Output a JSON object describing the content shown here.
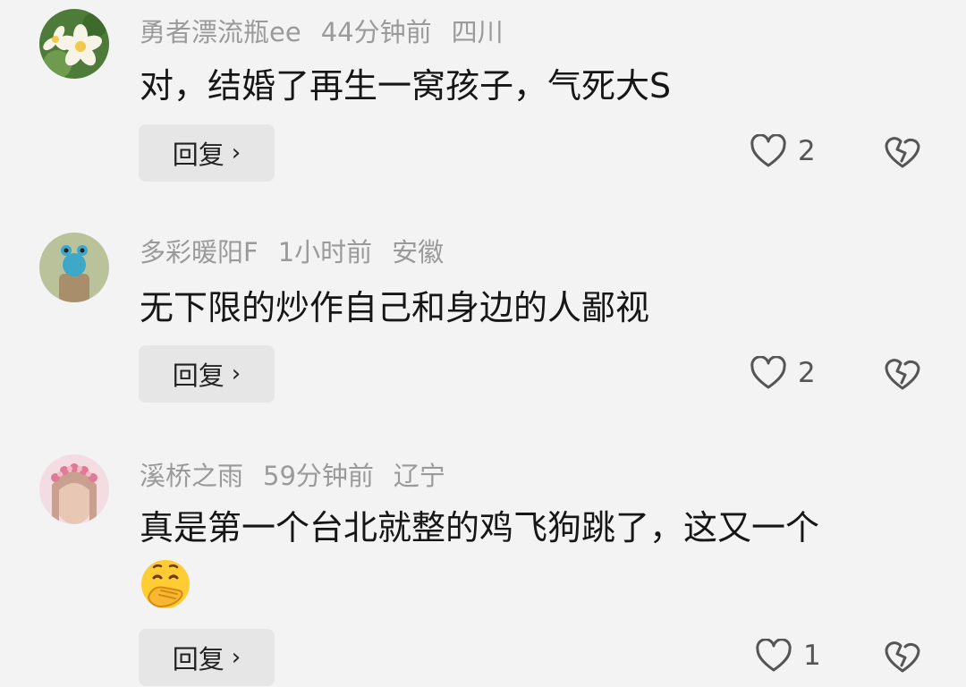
{
  "comments": [
    {
      "username": "勇者漂流瓶ee",
      "time": "44分钟前",
      "location": "四川",
      "text": "对，结婚了再生一窝孩子，气死大S",
      "reply_label": "回复",
      "likes": "2"
    },
    {
      "username": "多彩暖阳F",
      "time": "1小时前",
      "location": "安徽",
      "text": "无下限的炒作自己和身边的人鄙视",
      "reply_label": "回复",
      "likes": "2"
    },
    {
      "username": "溪桥之雨",
      "time": "59分钟前",
      "location": "辽宁",
      "text": "真是第一个台北就整的鸡飞狗跳了，这又一个",
      "emoji": "hand-over-mouth-emoji",
      "reply_label": "回复",
      "likes": "1"
    }
  ],
  "icons": {
    "like": "heart-outline-icon",
    "dislike": "broken-heart-icon",
    "reply_chevron": "chevron-right-icon"
  },
  "colors": {
    "background": "#f3f3f3",
    "reply_button": "#e6e6e6",
    "meta_text": "#9a9a9a",
    "body_text": "#161616"
  }
}
